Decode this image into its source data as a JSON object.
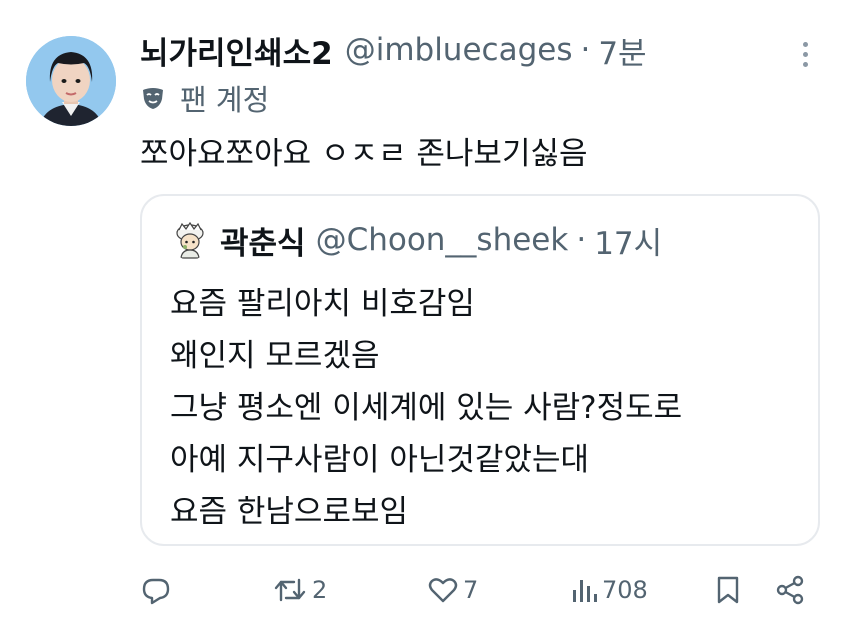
{
  "tweet": {
    "display_name": "뇌가리인쇄소2",
    "handle": "@imbluecages",
    "separator": "·",
    "time": "7분",
    "fan_account_label": "팬 계정",
    "text": "쪼아요쪼아요 ㅇㅈㄹ 존나보기싫음"
  },
  "quote": {
    "display_name": "곽춘식",
    "handle": "@Choon__sheek",
    "separator": "·",
    "time": "17시",
    "lines": [
      "요즘 팔리아치 비호감임",
      "왜인지 모르겠음",
      "그냥 평소엔 이세계에 있는 사람?정도로",
      "아예 지구사람이 아닌것같았는대",
      "요즘 한남으로보임"
    ]
  },
  "actions": {
    "reply": {
      "icon": "reply-icon"
    },
    "retweet": {
      "icon": "retweet-icon",
      "count": "2"
    },
    "like": {
      "icon": "heart-icon",
      "count": "7"
    },
    "views": {
      "icon": "views-chart-icon",
      "count": "708"
    },
    "bookmark": {
      "icon": "bookmark-icon"
    },
    "share": {
      "icon": "share-icon"
    }
  },
  "colors": {
    "text_primary": "#0f1419",
    "text_secondary": "#536471",
    "border": "#e7eaee"
  }
}
